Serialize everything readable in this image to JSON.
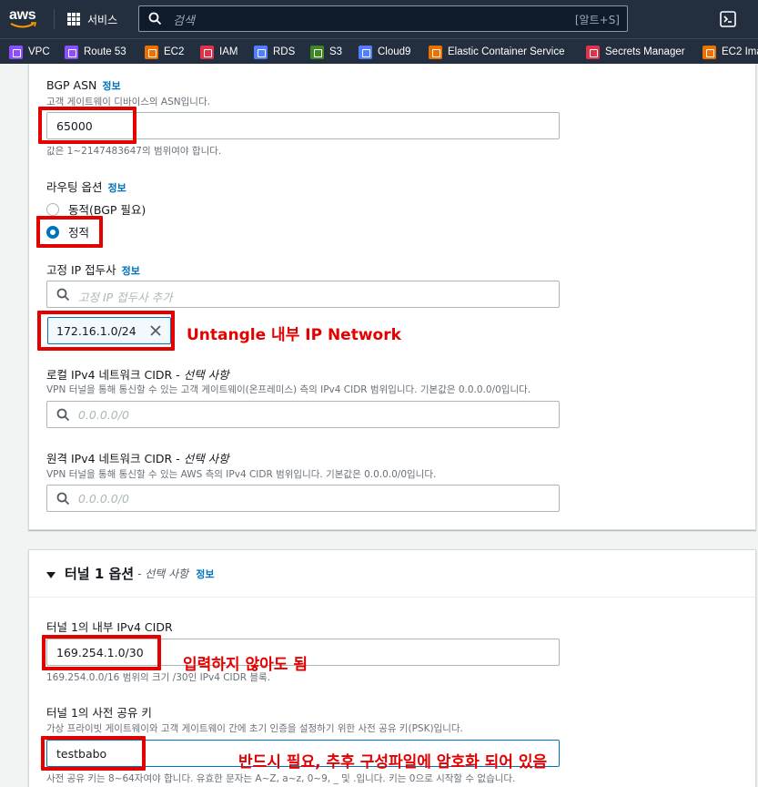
{
  "topnav": {
    "logo_text": "aws",
    "services_label": "서비스",
    "search_placeholder": "검색",
    "search_shortcut": "[알트+S]",
    "cloudshell_icon": "terminal-icon"
  },
  "favorites": [
    {
      "label": "VPC",
      "color": "#8c4fff"
    },
    {
      "label": "Route 53",
      "color": "#8c4fff"
    },
    {
      "label": "EC2",
      "color": "#ed7100"
    },
    {
      "label": "IAM",
      "color": "#dd344c"
    },
    {
      "label": "RDS",
      "color": "#527fff"
    },
    {
      "label": "S3",
      "color": "#3f8624"
    },
    {
      "label": "Cloud9",
      "color": "#527fff"
    },
    {
      "label": "Elastic Container Service",
      "color": "#ed7100"
    },
    {
      "label": "Secrets Manager",
      "color": "#dd344c"
    },
    {
      "label": "EC2 Ima",
      "color": "#ed7100"
    }
  ],
  "form": {
    "info_link": "정보",
    "bgp_asn": {
      "label": "BGP ASN",
      "desc": "고객 게이트웨이 디바이스의 ASN입니다.",
      "value": "65000",
      "hint": "값은 1~2147483647의 범위여야 합니다."
    },
    "routing": {
      "label": "라우팅 옵션",
      "options": [
        "동적(BGP 필요)",
        "정적"
      ],
      "selected": "정적"
    },
    "static_prefix": {
      "label": "고정 IP 접두사",
      "placeholder": "고정 IP 접두사 추가",
      "token": "172.16.1.0/24"
    },
    "local_cidr": {
      "label": "로컬 IPv4 네트워크 CIDR - ",
      "optional": "선택 사항",
      "desc": "VPN 터널을 통해 통신할 수 있는 고객 게이트웨이(온프레미스) 측의 IPv4 CIDR 범위입니다. 기본값은 0.0.0.0/0입니다.",
      "placeholder": "0.0.0.0/0"
    },
    "remote_cidr": {
      "label": "원격 IPv4 네트워크 CIDR - ",
      "optional": "선택 사항",
      "desc": "VPN 터널을 통해 통신할 수 있는 AWS 측의 IPv4 CIDR 범위입니다. 기본값은 0.0.0.0/0입니다.",
      "placeholder": "0.0.0.0/0"
    }
  },
  "tunnel": {
    "title": "터널 1 옵션",
    "optional": "- 선택 사항",
    "inside_cidr": {
      "label": "터널 1의 내부 IPv4 CIDR",
      "value": "169.254.1.0/30",
      "hint": "169.254.0.0/16 범위의 크기 /30인 IPv4 CIDR 블록."
    },
    "psk": {
      "label": "터널 1의 사전 공유 키",
      "desc": "가상 프라이빗 게이트웨이와 고객 게이트웨이 간에 초기 인증을 설정하기 위한 사전 공유 키(PSK)입니다.",
      "value": "testbabo",
      "hint": "사전 공유 키는 8~64자여야 합니다. 유효한 문자는 A~Z, a~z, 0~9, _ 및 .입니다. 키는 0으로 시작할 수 없습니다."
    }
  },
  "annotations": {
    "untangle": "Untangle 내부 IP Network",
    "no_input": "입력하지 않아도 됨",
    "required": "반드시 필요, 추후 구성파일에 암호화 되어 있음"
  }
}
